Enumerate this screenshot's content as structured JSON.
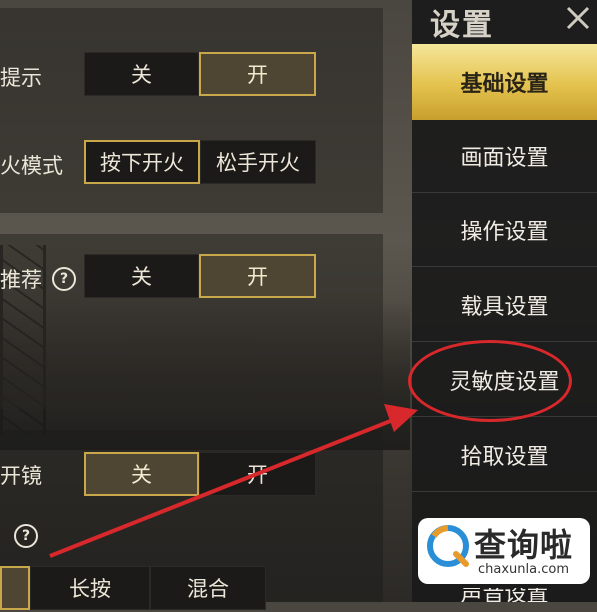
{
  "settings": {
    "row1": {
      "label": "提示",
      "options": [
        "关",
        "开"
      ]
    },
    "row2": {
      "label": "火模式",
      "options": [
        "按下开火",
        "松手开火"
      ]
    },
    "row3": {
      "label": "推荐",
      "options": [
        "关",
        "开"
      ]
    },
    "row4": {
      "label": "开镜",
      "options": [
        "关",
        "开"
      ]
    },
    "row5": {
      "options": [
        "长按",
        "混合"
      ]
    }
  },
  "menu": {
    "title": "设置",
    "items": [
      {
        "label": "基础设置"
      },
      {
        "label": "画面设置"
      },
      {
        "label": "操作设置"
      },
      {
        "label": "载具设置"
      },
      {
        "label": "灵敏度设置"
      },
      {
        "label": "拾取设置"
      }
    ],
    "bottom_peek": "声音设置"
  },
  "watermark": {
    "text": "查询啦",
    "url": "chaxunla.com"
  },
  "colors": {
    "accent_gold": "#c8a84a",
    "annotation_red": "#d9282b",
    "active_menu": "#e3c24d"
  }
}
